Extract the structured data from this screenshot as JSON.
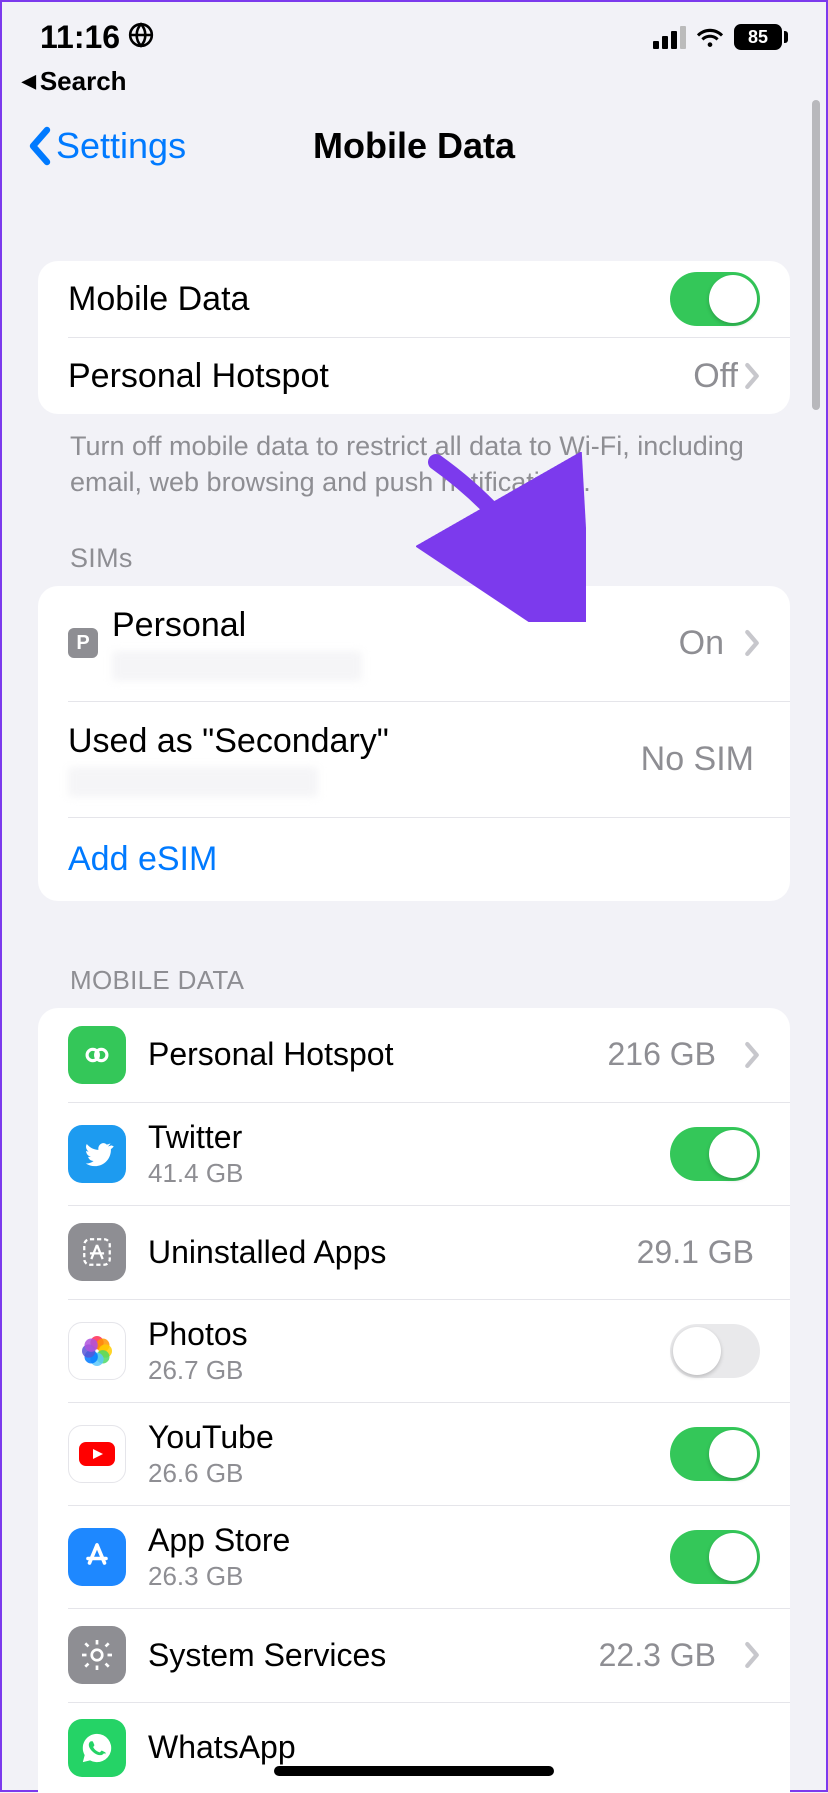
{
  "status": {
    "time": "11:16",
    "battery": "85"
  },
  "backSearch": "Search",
  "nav": {
    "back": "Settings",
    "title": "Mobile Data"
  },
  "section1": {
    "mobileDataLabel": "Mobile Data",
    "hotspotLabel": "Personal Hotspot",
    "hotspotValue": "Off",
    "footer": "Turn off mobile data to restrict all data to Wi-Fi, including email, web browsing and push notifications."
  },
  "sims": {
    "header": "SIMs",
    "items": [
      {
        "badge": "P",
        "name": "Personal",
        "value": "On"
      },
      {
        "name": "Used as \"Secondary\"",
        "value": "No SIM"
      }
    ],
    "addEsim": "Add eSIM"
  },
  "usage": {
    "header": "MOBILE DATA",
    "apps": [
      {
        "name": "Personal Hotspot",
        "size": "",
        "value": "216 GB",
        "icon": "hotspot",
        "chevron": true
      },
      {
        "name": "Twitter",
        "size": "41.4 GB",
        "value": "",
        "icon": "twitter",
        "toggle": true,
        "on": true
      },
      {
        "name": "Uninstalled Apps",
        "size": "",
        "value": "29.1 GB",
        "icon": "uninstalled"
      },
      {
        "name": "Photos",
        "size": "26.7 GB",
        "value": "",
        "icon": "photos",
        "toggle": true,
        "on": false
      },
      {
        "name": "YouTube",
        "size": "26.6 GB",
        "value": "",
        "icon": "youtube",
        "toggle": true,
        "on": true
      },
      {
        "name": "App Store",
        "size": "26.3 GB",
        "value": "",
        "icon": "appstore",
        "toggle": true,
        "on": true
      },
      {
        "name": "System Services",
        "size": "",
        "value": "22.3 GB",
        "icon": "system",
        "chevron": true
      },
      {
        "name": "WhatsApp",
        "size": "",
        "value": "",
        "icon": "whatsapp"
      }
    ]
  }
}
